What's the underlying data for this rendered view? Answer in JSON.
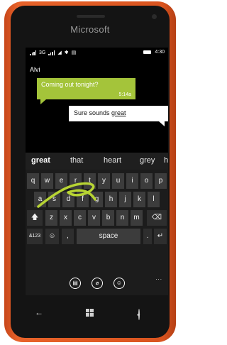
{
  "device": {
    "brand": "Microsoft"
  },
  "status_bar": {
    "network_1": "3G",
    "time": "4:30"
  },
  "conversation": {
    "contact": "Alvi",
    "incoming": {
      "text": "Coming out tonight?",
      "time": "5:14a"
    },
    "outgoing": {
      "text_before": "Sure sounds ",
      "text_underlined": "great"
    }
  },
  "suggestions": [
    "great",
    "that",
    "heart",
    "grey",
    "h"
  ],
  "keyboard": {
    "row1": [
      "q",
      "w",
      "e",
      "r",
      "t",
      "y",
      "u",
      "i",
      "o",
      "p"
    ],
    "row2": [
      "a",
      "s",
      "d",
      "f",
      "g",
      "h",
      "j",
      "k",
      "l"
    ],
    "row3": [
      "z",
      "x",
      "c",
      "v",
      "b",
      "n",
      "m"
    ],
    "numbers_key": "&123",
    "emoji_key": "☺",
    "comma_key": ",",
    "space_key": "space",
    "period_key": ".",
    "shift_symbol": "🡅",
    "backspace_symbol": "⌫",
    "enter_symbol": "↵",
    "more_symbol": "..."
  },
  "swipe_trace_color": "#b7d433",
  "accent_green": "#a4c43a",
  "nav": {
    "back": "←",
    "search": "search"
  }
}
